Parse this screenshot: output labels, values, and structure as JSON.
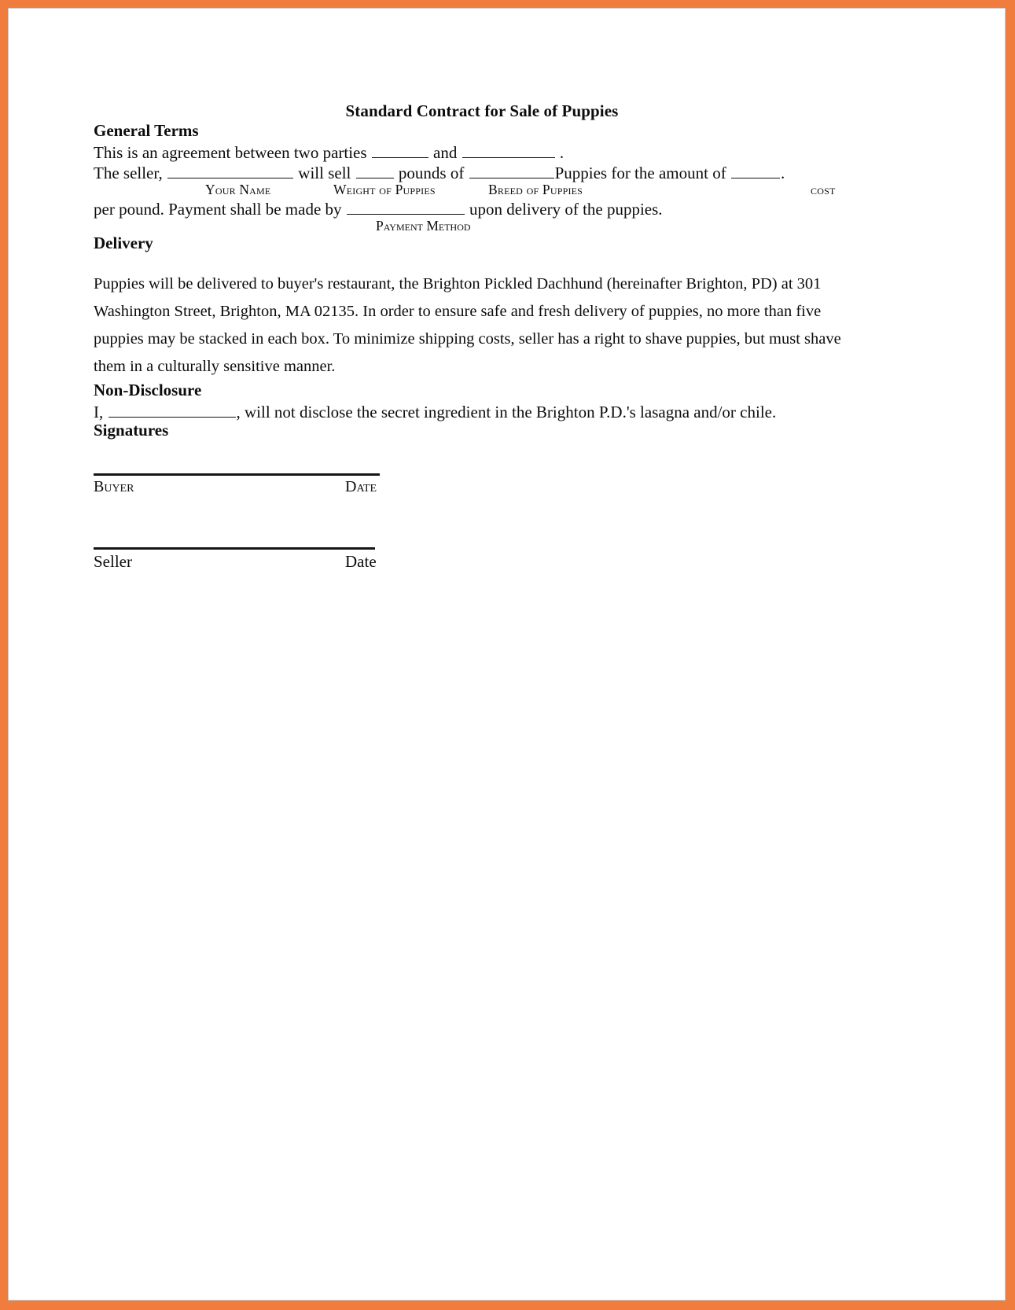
{
  "page": {
    "accent_border_color": "#F07C3E",
    "page_background": "#FFFFFF",
    "text_color": "#0C0C0C"
  },
  "document": {
    "title": "Standard Contract for Sale of Puppies",
    "sections": {
      "general_terms": {
        "heading": "General Terms",
        "parties_line": {
          "part1": "This is an agreement between two parties ",
          "part2": " and ",
          "part3": " ."
        },
        "seller_line": {
          "part1": "The seller, ",
          "part2": " will sell ",
          "part3": " pounds of ",
          "part4": "Puppies for the amount of ",
          "part5": "."
        },
        "field_captions": {
          "your_name": "Your Name",
          "weight_of_puppies": "Weight of Puppies",
          "breed_of_puppies": "Breed of Puppies",
          "cost": "cost",
          "payment_method": "Payment Method"
        },
        "payment_line": {
          "part1": "per pound.  Payment shall be made by ",
          "part2": " upon delivery of the puppies."
        }
      },
      "delivery": {
        "heading": "Delivery",
        "body": "Puppies will be delivered to buyer's restaurant, the Brighton Pickled Dachhund (hereinafter Brighton, PD) at 301 Washington Street, Brighton, MA 02135.  In order to ensure safe and fresh delivery of puppies, no more than five puppies may be stacked in each box.  To minimize shipping costs, seller has a right to shave puppies, but must shave them in a culturally sensitive manner."
      },
      "non_disclosure": {
        "heading": "Non-Disclosure",
        "line": {
          "part1": "I, ",
          "part2": ", will not disclose the secret ingredient in the Brighton P.D.'s lasagna and/or chile."
        }
      },
      "signatures": {
        "heading": "Signatures",
        "rows": [
          {
            "left_label": "Buyer",
            "right_label": "Date"
          },
          {
            "left_label": "Seller",
            "right_label": "Date"
          }
        ]
      }
    }
  }
}
